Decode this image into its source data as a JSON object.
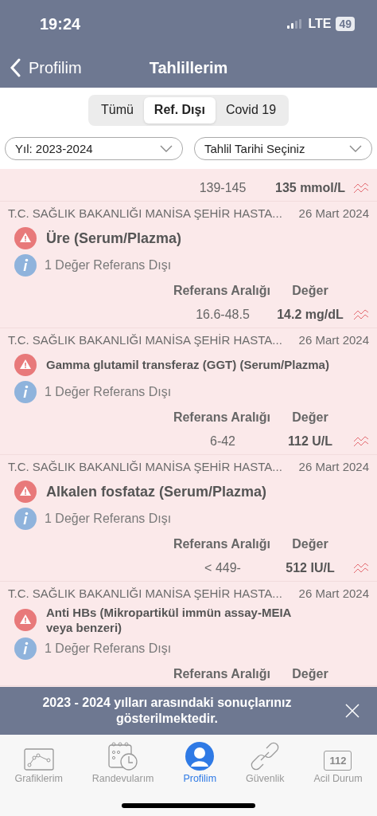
{
  "status_bar": {
    "time": "19:24",
    "network": "LTE",
    "battery": "49"
  },
  "nav": {
    "back": "Profilim",
    "title": "Tahlillerim"
  },
  "segments": [
    {
      "label": "Tümü",
      "selected": false
    },
    {
      "label": "Ref. Dışı",
      "selected": true
    },
    {
      "label": "Covid 19",
      "selected": false
    }
  ],
  "filters": [
    {
      "value": "Yıl: 2023-2024"
    },
    {
      "value": "Tahlil Tarihi Seçiniz"
    }
  ],
  "results": [
    {
      "kind": "partial",
      "range": "139-145",
      "value": "135 mmol/L"
    },
    {
      "kind": "full",
      "hospital": "T.C. SAĞLIK BAKANLIĞI MANİSA ŞEHİR HASTA...",
      "date": "26 Mart 2024",
      "test": "Üre (Serum/Plazma)",
      "info": "1 Değer Referans Dışı",
      "range_header": "Referans Aralığı",
      "value_header": "Değer",
      "range": "16.6-48.5",
      "value": "14.2 mg/dL"
    },
    {
      "kind": "full",
      "hospital": "T.C. SAĞLIK BAKANLIĞI MANİSA ŞEHİR HASTA...",
      "date": "26 Mart 2024",
      "test": "Gamma glutamil transferaz (GGT) (Serum/Plazma)",
      "info": "1 Değer Referans Dışı",
      "range_header": "Referans Aralığı",
      "value_header": "Değer",
      "range": "6-42",
      "value": "112 U/L"
    },
    {
      "kind": "full",
      "hospital": "T.C. SAĞLIK BAKANLIĞI MANİSA ŞEHİR HASTA...",
      "date": "26 Mart 2024",
      "test": "Alkalen fosfataz (Serum/Plazma)",
      "info": "1 Değer Referans Dışı",
      "range_header": "Referans Aralığı",
      "value_header": "Değer",
      "range": "< 449-",
      "value": "512 IU/L"
    },
    {
      "kind": "full",
      "hospital": "T.C. SAĞLIK BAKANLIĞI MANİSA ŞEHİR HASTA...",
      "date": "26 Mart 2024",
      "test": "Anti HBs  (Mikropartikül immün assay-MEIA veya benzeri)",
      "info": "1 Değer Referans Dışı",
      "range_header": "Referans Aralığı",
      "value_header": "Değer"
    }
  ],
  "toast": {
    "message": "2023 - 2024 yılları arasındaki sonuçlarınız gösterilmektedir."
  },
  "tabbar": [
    {
      "label": "Grafiklerim",
      "selected": false
    },
    {
      "label": "Randevularım",
      "selected": false
    },
    {
      "label": "Profilim",
      "selected": true
    },
    {
      "label": "Güvenlik",
      "selected": false
    },
    {
      "label": "Acil Durum",
      "badge": "112",
      "selected": false
    }
  ]
}
